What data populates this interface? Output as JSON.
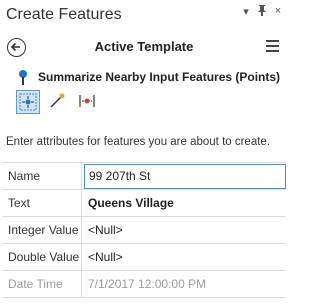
{
  "window": {
    "title": "Create Features",
    "controls": [
      "▾",
      "pin",
      "×"
    ]
  },
  "header": {
    "title": "Active Template"
  },
  "template": {
    "name": "Summarize Nearby Input Features (Points)"
  },
  "tools": [
    "point-tool",
    "line-tool",
    "midpoint-tool"
  ],
  "hint": "Enter attributes for features you are about to create.",
  "attributes": [
    {
      "label": "Name",
      "value": "99 207th St"
    },
    {
      "label": "Text",
      "value": "Queens Village"
    },
    {
      "label": "Integer Value",
      "value": "<Null>"
    },
    {
      "label": "Double Value",
      "value": "<Null>"
    },
    {
      "label": "Date Time",
      "value": "7/1/2017 12:00:00 PM"
    }
  ],
  "colors": {
    "accent": "#4a90d9",
    "pin": "#1f74c9",
    "active_tool_bg": "#cfe3f6"
  }
}
